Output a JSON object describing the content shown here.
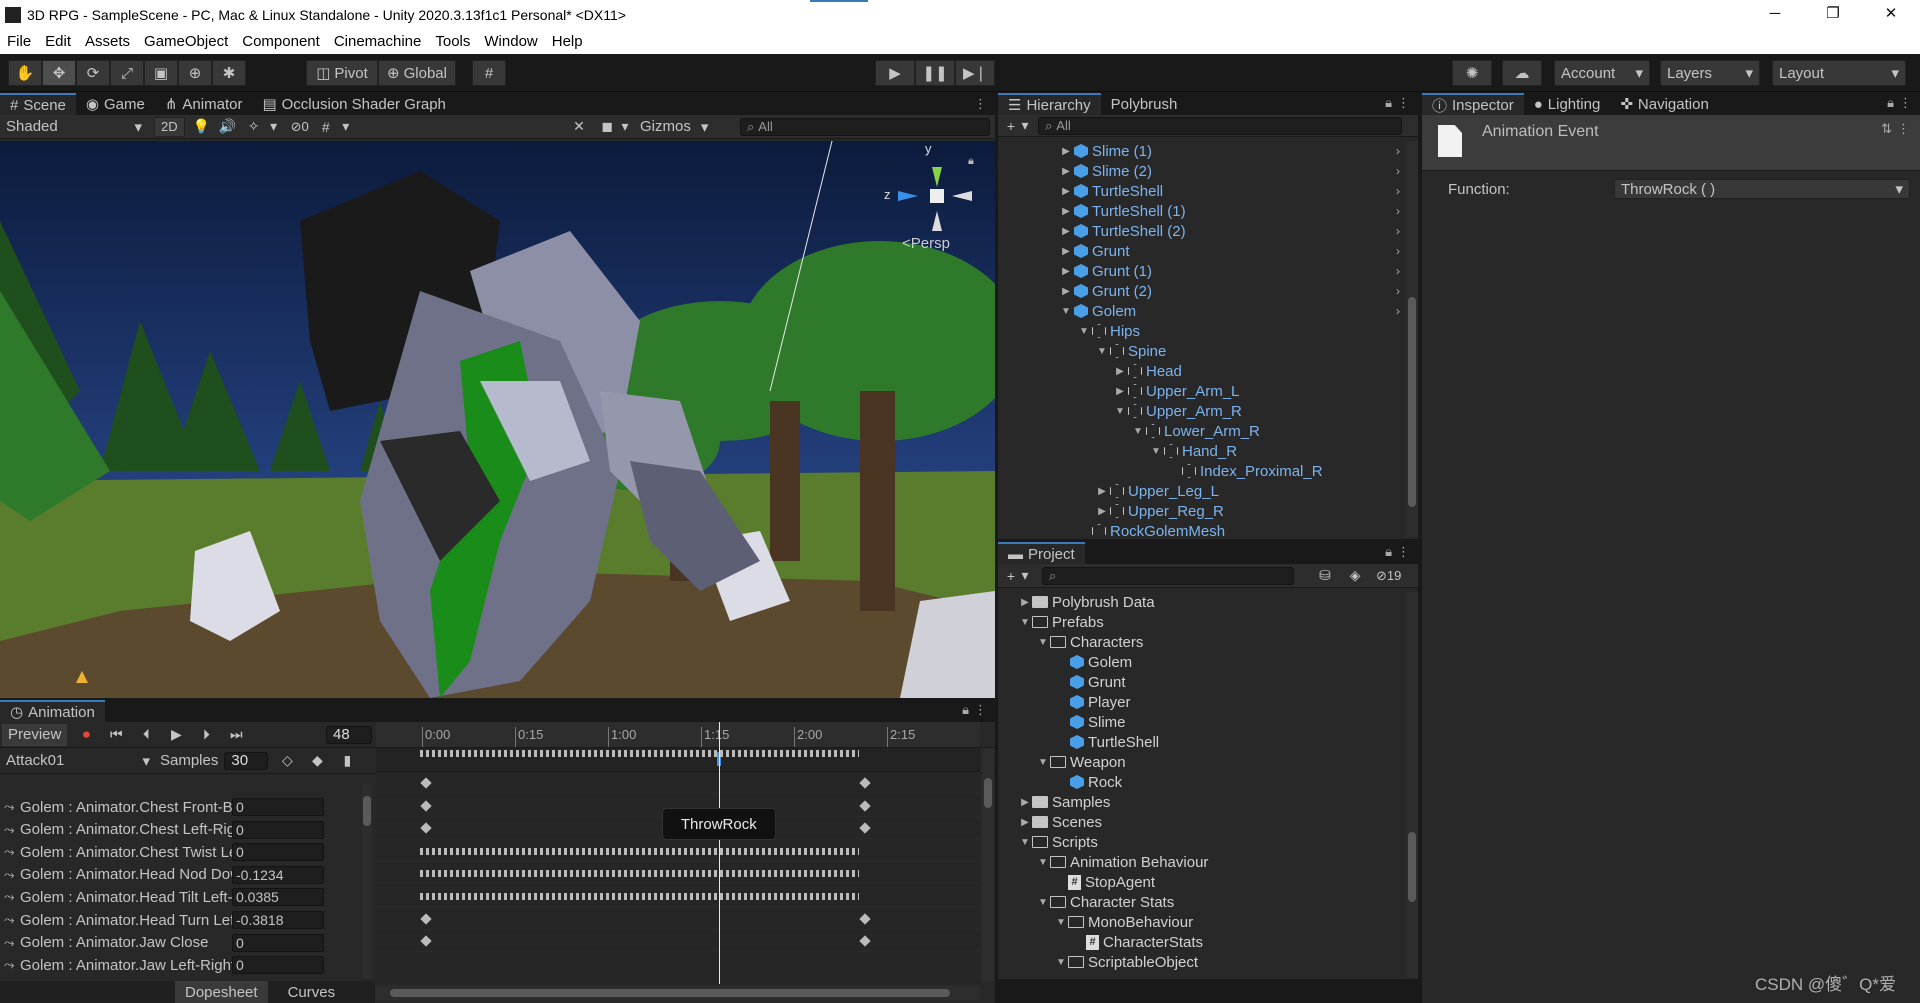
{
  "window": {
    "title": "3D RPG - SampleScene - PC, Mac & Linux Standalone - Unity 2020.3.13f1c1 Personal* <DX11>"
  },
  "menu": [
    "File",
    "Edit",
    "Assets",
    "GameObject",
    "Component",
    "Cinemachine",
    "Tools",
    "Window",
    "Help"
  ],
  "toolbar": {
    "pivot": "Pivot",
    "global": "Global",
    "account": "Account",
    "layers": "Layers",
    "layout": "Layout"
  },
  "scene": {
    "tabs": [
      "Scene",
      "Game",
      "Animator",
      "Occlusion Shader Graph"
    ],
    "shading": "Shaded",
    "mode2d": "2D",
    "hidden_count": "0",
    "gizmos": "Gizmos",
    "search_placeholder": "All",
    "persp": "Persp",
    "axis_y": "y",
    "axis_z": "z"
  },
  "hierarchy": {
    "tabs": [
      "Hierarchy",
      "Polybrush"
    ],
    "search_placeholder": "All",
    "items": [
      {
        "label": "Slime (1)",
        "depth": 0,
        "type": "prefab",
        "arrow": "right",
        "more": true
      },
      {
        "label": "Slime (2)",
        "depth": 0,
        "type": "prefab",
        "arrow": "right",
        "more": true
      },
      {
        "label": "TurtleShell",
        "depth": 0,
        "type": "prefab",
        "arrow": "right",
        "more": true
      },
      {
        "label": "TurtleShell (1)",
        "depth": 0,
        "type": "prefab",
        "arrow": "right",
        "more": true
      },
      {
        "label": "TurtleShell (2)",
        "depth": 0,
        "type": "prefab",
        "arrow": "right",
        "more": true
      },
      {
        "label": "Grunt",
        "depth": 0,
        "type": "prefab",
        "arrow": "right",
        "more": true
      },
      {
        "label": "Grunt (1)",
        "depth": 0,
        "type": "prefab",
        "arrow": "right",
        "more": true
      },
      {
        "label": "Grunt (2)",
        "depth": 0,
        "type": "prefab",
        "arrow": "right",
        "more": true
      },
      {
        "label": "Golem",
        "depth": 0,
        "type": "prefab",
        "arrow": "down",
        "more": true
      },
      {
        "label": "Hips",
        "depth": 1,
        "type": "object",
        "arrow": "down"
      },
      {
        "label": "Spine",
        "depth": 2,
        "type": "object",
        "arrow": "down"
      },
      {
        "label": "Head",
        "depth": 3,
        "type": "object",
        "arrow": "right"
      },
      {
        "label": "Upper_Arm_L",
        "depth": 3,
        "type": "object",
        "arrow": "right"
      },
      {
        "label": "Upper_Arm_R",
        "depth": 3,
        "type": "object",
        "arrow": "down"
      },
      {
        "label": "Lower_Arm_R",
        "depth": 4,
        "type": "object",
        "arrow": "down"
      },
      {
        "label": "Hand_R",
        "depth": 5,
        "type": "object",
        "arrow": "down"
      },
      {
        "label": "Index_Proximal_R",
        "depth": 6,
        "type": "object",
        "arrow": ""
      },
      {
        "label": "Upper_Leg_L",
        "depth": 2,
        "type": "object",
        "arrow": "right"
      },
      {
        "label": "Upper_Reg_R",
        "depth": 2,
        "type": "object",
        "arrow": "right"
      },
      {
        "label": "RockGolemMesh",
        "depth": 1,
        "type": "object",
        "arrow": ""
      }
    ]
  },
  "project": {
    "tab": "Project",
    "hidden_count": "19",
    "items": [
      {
        "label": "Polybrush Data",
        "depth": 0,
        "type": "folder",
        "arrow": "right"
      },
      {
        "label": "Prefabs",
        "depth": 0,
        "type": "folder-open",
        "arrow": "down"
      },
      {
        "label": "Characters",
        "depth": 1,
        "type": "folder-open",
        "arrow": "down"
      },
      {
        "label": "Golem",
        "depth": 2,
        "type": "prefab",
        "arrow": ""
      },
      {
        "label": "Grunt",
        "depth": 2,
        "type": "prefab",
        "arrow": ""
      },
      {
        "label": "Player",
        "depth": 2,
        "type": "prefab",
        "arrow": ""
      },
      {
        "label": "Slime",
        "depth": 2,
        "type": "prefab",
        "arrow": ""
      },
      {
        "label": "TurtleShell",
        "depth": 2,
        "type": "prefab",
        "arrow": ""
      },
      {
        "label": "Weapon",
        "depth": 1,
        "type": "folder-open",
        "arrow": "down"
      },
      {
        "label": "Rock",
        "depth": 2,
        "type": "prefab",
        "arrow": ""
      },
      {
        "label": "Samples",
        "depth": 0,
        "type": "folder",
        "arrow": "right"
      },
      {
        "label": "Scenes",
        "depth": 0,
        "type": "folder",
        "arrow": "right"
      },
      {
        "label": "Scripts",
        "depth": 0,
        "type": "folder-open",
        "arrow": "down"
      },
      {
        "label": "Animation Behaviour",
        "depth": 1,
        "type": "folder-open",
        "arrow": "down"
      },
      {
        "label": "StopAgent",
        "depth": 2,
        "type": "script",
        "arrow": ""
      },
      {
        "label": "Character Stats",
        "depth": 1,
        "type": "folder-open",
        "arrow": "down"
      },
      {
        "label": "MonoBehaviour",
        "depth": 2,
        "type": "folder-open",
        "arrow": "down"
      },
      {
        "label": "CharacterStats",
        "depth": 3,
        "type": "script",
        "arrow": ""
      },
      {
        "label": "ScriptableObject",
        "depth": 2,
        "type": "folder-open",
        "arrow": "down"
      }
    ]
  },
  "inspector": {
    "tabs": [
      "Inspector",
      "Lighting",
      "Navigation"
    ],
    "header": "Animation Event",
    "function_label": "Function:",
    "function_value": "ThrowRock ( )"
  },
  "animation": {
    "tab": "Animation",
    "preview": "Preview",
    "frame": "48",
    "clip": "Attack01",
    "samples_label": "Samples",
    "samples": "30",
    "timeline_labels": [
      "0:00",
      "0:15",
      "1:00",
      "1:15",
      "2:00",
      "2:15"
    ],
    "playhead_frame": 48,
    "event_tooltip": "ThrowRock",
    "bottom_tabs": [
      "Dopesheet",
      "Curves"
    ],
    "properties": [
      {
        "name": "Golem : Animator.Chest Front-Back",
        "value": "0",
        "dense": false
      },
      {
        "name": "Golem : Animator.Chest Left-Right",
        "value": "0",
        "dense": false
      },
      {
        "name": "Golem : Animator.Chest Twist Left-Right",
        "value": "0",
        "dense": false
      },
      {
        "name": "Golem : Animator.Head Nod Down-Up",
        "value": "-0.1234",
        "dense": true
      },
      {
        "name": "Golem : Animator.Head Tilt Left-Right",
        "value": "0.0385",
        "dense": true
      },
      {
        "name": "Golem : Animator.Head Turn Left-Right",
        "value": "-0.3818",
        "dense": true
      },
      {
        "name": "Golem : Animator.Jaw Close",
        "value": "0",
        "dense": false
      },
      {
        "name": "Golem : Animator.Jaw Left-Right",
        "value": "0",
        "dense": false
      }
    ]
  },
  "watermark": "CSDN @傻゛Q*爱",
  "colors": {
    "accent": "#3a79bb",
    "prefab": "#4aa0e8",
    "link_text": "#7cb3ee"
  }
}
